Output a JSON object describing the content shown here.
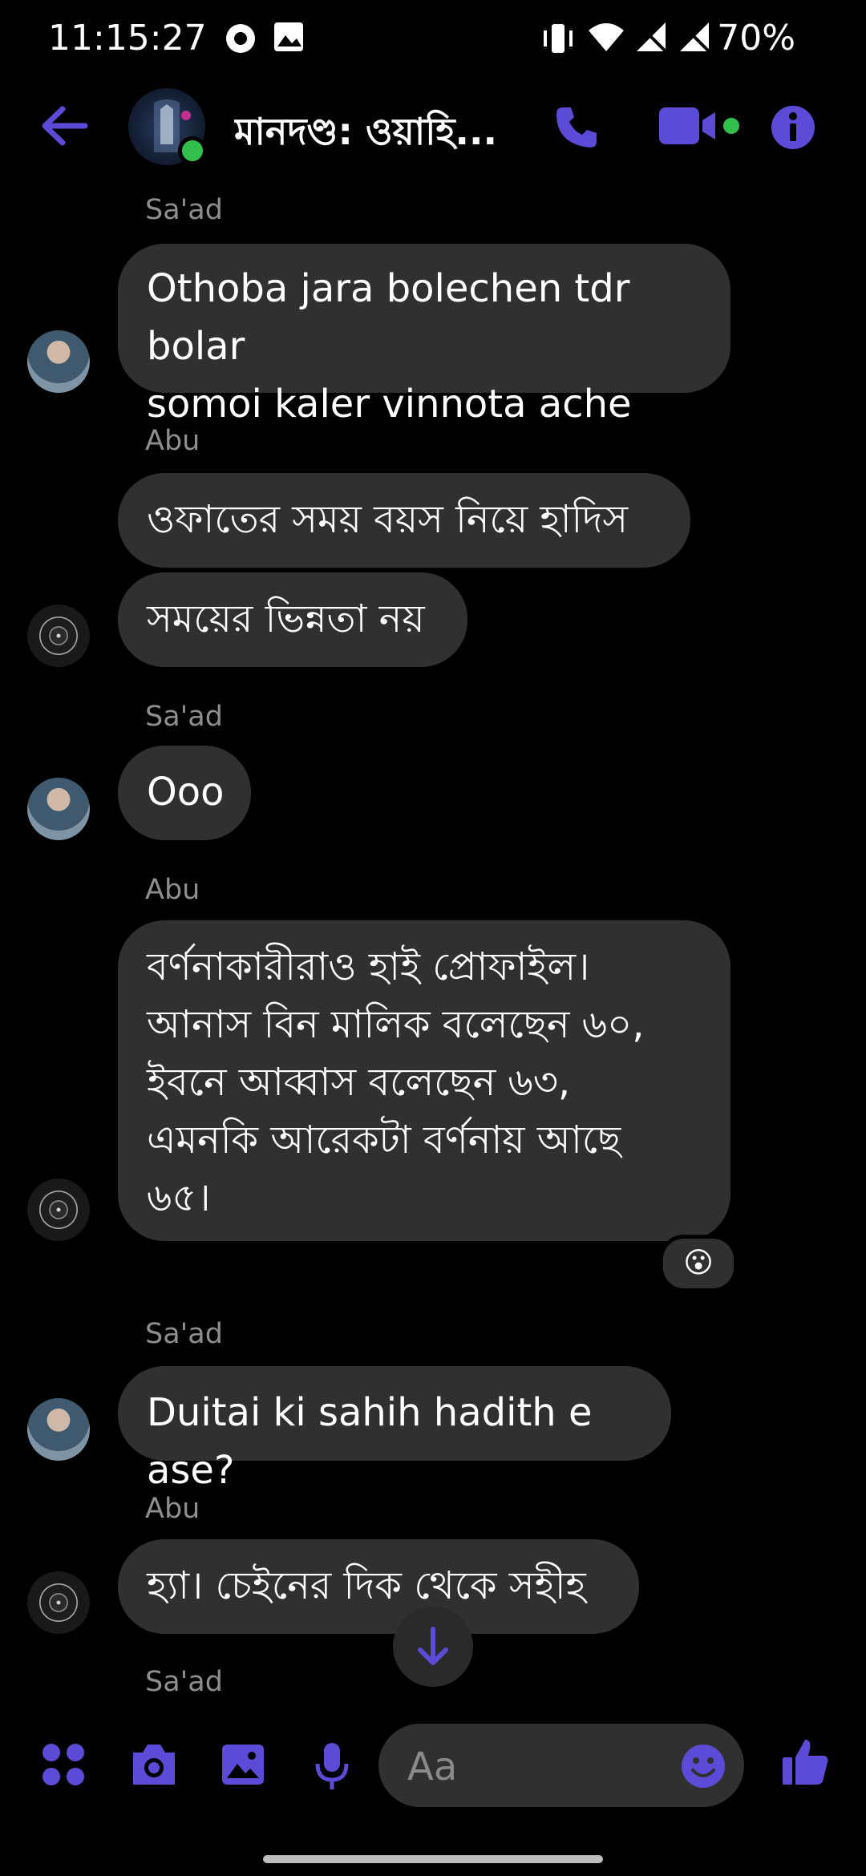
{
  "status_bar": {
    "time": "11:15:27",
    "battery": "70%"
  },
  "header": {
    "title": "মানদণ্ড: ওয়াহি..."
  },
  "colors": {
    "accent": "#5b4bd6",
    "bubble": "#303030",
    "online": "#31c04e"
  },
  "messages": [
    {
      "sender": "Sa'ad",
      "lines": [
        "Othoba jara bolechen tdr bolar",
        "somoi kaler vinnota ache"
      ]
    },
    {
      "sender": "Abu",
      "lines": [
        "ওফাতের সময় বয়স নিয়ে হাদিস"
      ]
    },
    {
      "sender": "",
      "lines": [
        "সময়ের ভিন্নতা নয়"
      ]
    },
    {
      "sender": "Sa'ad",
      "lines": [
        "Ooo"
      ]
    },
    {
      "sender": "Abu",
      "lines": [
        "বর্ণনাকারীরাও হাই প্রোফাইল।",
        "আনাস বিন মালিক বলেছেন ৬০,",
        "ইবনে আব্বাস বলেছেন ৬৩,",
        "এমনকি আরেকটা বর্ণনায় আছে",
        "৬৫।"
      ],
      "reaction": "😮"
    },
    {
      "sender": "Sa'ad",
      "lines": [
        "Duitai ki sahih hadith e ase?"
      ]
    },
    {
      "sender": "Abu",
      "lines": [
        "হ্যা। চেইনের দিক থেকে সহীহ"
      ]
    },
    {
      "sender": "Sa'ad",
      "lines": []
    }
  ],
  "composer": {
    "placeholder": "Aa"
  },
  "icons": [
    "back-arrow-icon",
    "phone-icon",
    "video-icon",
    "info-icon",
    "apps-icon",
    "camera-icon",
    "gallery-icon",
    "microphone-icon",
    "emoji-icon",
    "like-icon",
    "scroll-down-icon"
  ]
}
